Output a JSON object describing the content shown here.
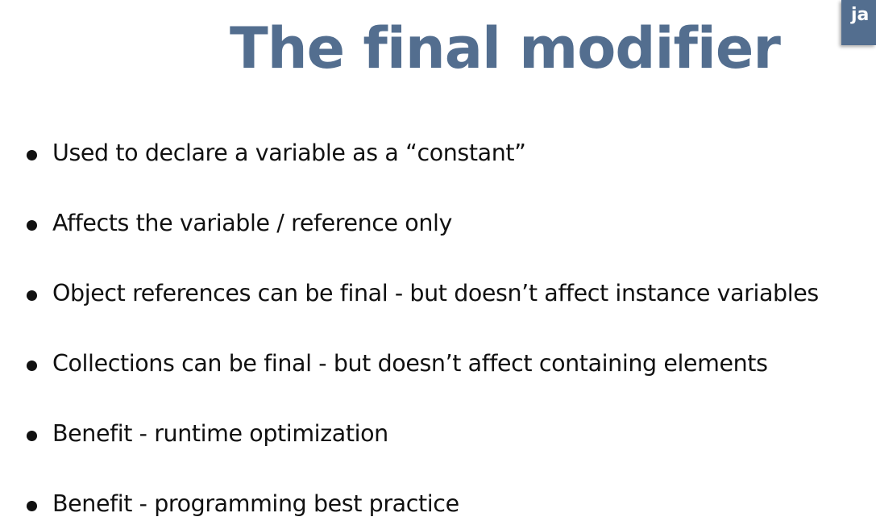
{
  "slide": {
    "title": "The final modifier",
    "corner_badge": "ja",
    "bullets": [
      "Used to declare a variable as a “constant”",
      "Affects the variable / reference only",
      "Object references can be final - but doesn’t affect instance variables",
      "Collections can be final - but doesn’t affect containing elements",
      "Benefit - runtime optimization",
      "Benefit - programming best practice"
    ]
  },
  "colors": {
    "title": "#536e8f",
    "badge_background": "#536e8f",
    "text": "#111111",
    "background": "#ffffff"
  }
}
